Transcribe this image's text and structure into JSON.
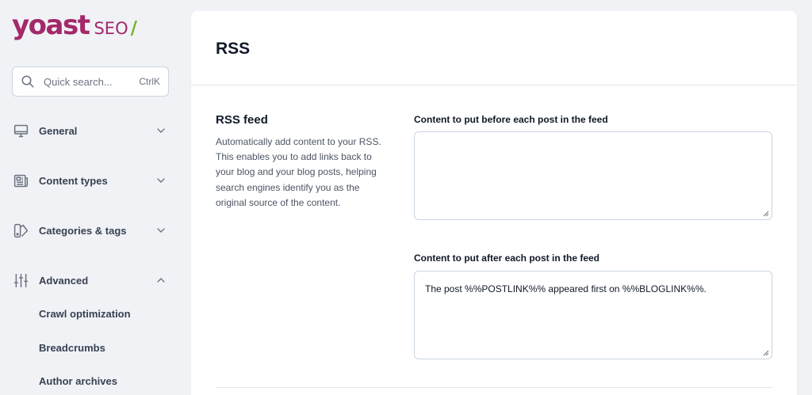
{
  "brand": {
    "word": "yoast",
    "product": "SEO",
    "slash": "/",
    "primary_color": "#a4286a",
    "accent_color": "#77b227"
  },
  "search": {
    "placeholder": "Quick search...",
    "shortcut": "CtrlK",
    "icon": "search-icon"
  },
  "sidebar": {
    "items": [
      {
        "label": "General",
        "icon": "monitor-icon",
        "expanded": false
      },
      {
        "label": "Content types",
        "icon": "newspaper-icon",
        "expanded": false
      },
      {
        "label": "Categories & tags",
        "icon": "tag-swatch-icon",
        "expanded": false
      },
      {
        "label": "Advanced",
        "icon": "sliders-icon",
        "expanded": true
      }
    ],
    "advanced_children": [
      "Crawl optimization",
      "Breadcrumbs",
      "Author archives"
    ]
  },
  "main": {
    "title": "RSS",
    "section": {
      "title": "RSS feed",
      "description": "Automatically add content to your RSS. This enables you to add links back to your blog and your blog posts, helping search engines identify you as the original source of the content."
    },
    "fields": [
      {
        "label": "Content to put before each post in the feed",
        "value": ""
      },
      {
        "label": "Content to put after each post in the feed",
        "value": "The post %%POSTLINK%% appeared first on %%BLOGLINK%%."
      }
    ]
  }
}
